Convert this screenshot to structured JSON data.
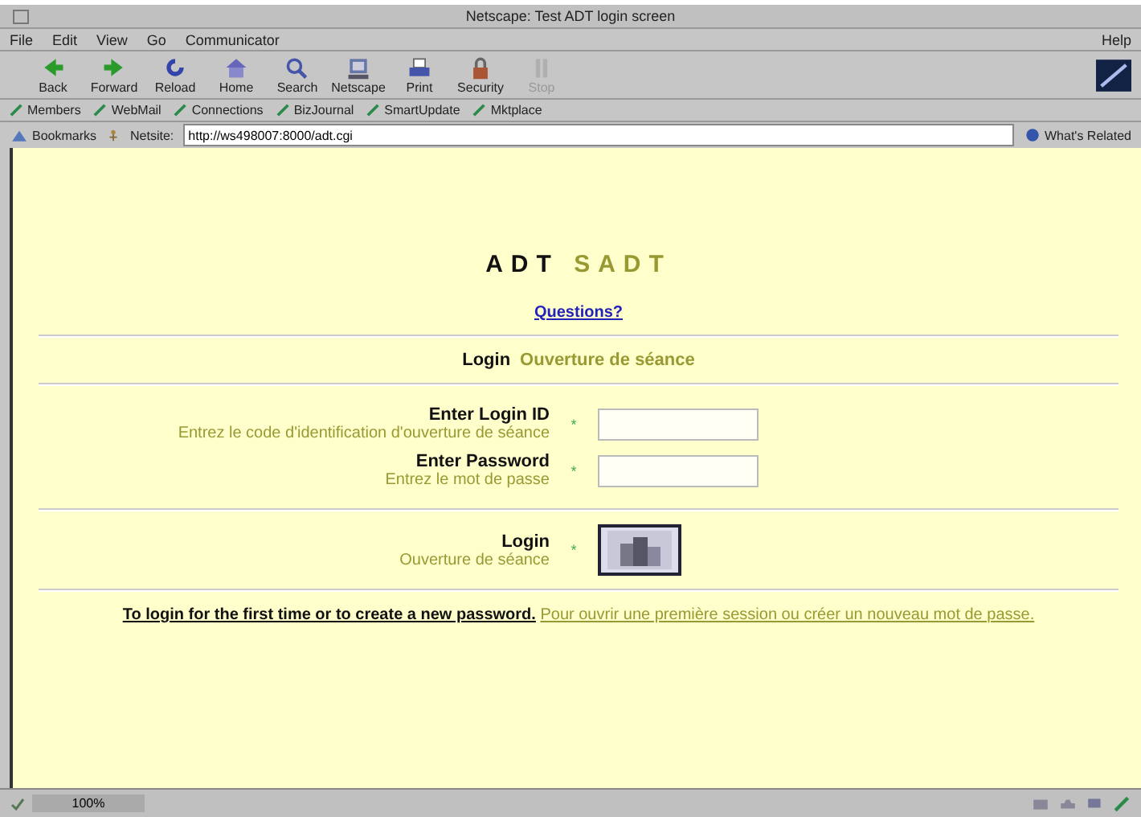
{
  "window": {
    "title": "Netscape: Test ADT login screen"
  },
  "menu": [
    "File",
    "Edit",
    "View",
    "Go",
    "Communicator"
  ],
  "help_menu": "Help",
  "toolbar": [
    {
      "kind": "back",
      "label": "Back",
      "disabled": false
    },
    {
      "kind": "forward",
      "label": "Forward",
      "disabled": false
    },
    {
      "kind": "reload",
      "label": "Reload",
      "disabled": false
    },
    {
      "kind": "home",
      "label": "Home",
      "disabled": false
    },
    {
      "kind": "search",
      "label": "Search",
      "disabled": false
    },
    {
      "kind": "netscape",
      "label": "Netscape",
      "disabled": false
    },
    {
      "kind": "print",
      "label": "Print",
      "disabled": false
    },
    {
      "kind": "security",
      "label": "Security",
      "disabled": false
    },
    {
      "kind": "stop",
      "label": "Stop",
      "disabled": true
    }
  ],
  "personal_toolbar": [
    "Members",
    "WebMail",
    "Connections",
    "BizJournal",
    "SmartUpdate",
    "Mktplace"
  ],
  "location": {
    "bookmarks": "Bookmarks",
    "label": "Netsite:",
    "url": "http://ws498007:8000/adt.cgi",
    "related": "What's Related"
  },
  "page": {
    "title_en": "ADT",
    "title_fr": "SADT",
    "help_link": "Questions?",
    "section": {
      "en": "Login",
      "fr": "Ouverture de séance"
    },
    "fields": [
      {
        "label": "Enter Login ID",
        "label_fr": "Entrez le code d'identification d'ouverture de séance",
        "required_mark": "*"
      },
      {
        "label": "Enter Password",
        "label_fr": "Entrez le mot de passe",
        "required_mark": "*"
      }
    ],
    "submit": {
      "label": "Login",
      "label_fr": "Ouverture de séance",
      "required_mark": "*"
    },
    "footer": {
      "link_en": "To login for the first time or to create a new password.",
      "link_fr": "Pour ouvrir une première session ou créer un nouveau mot de passe."
    }
  },
  "status_bar": {
    "text": "100%"
  }
}
